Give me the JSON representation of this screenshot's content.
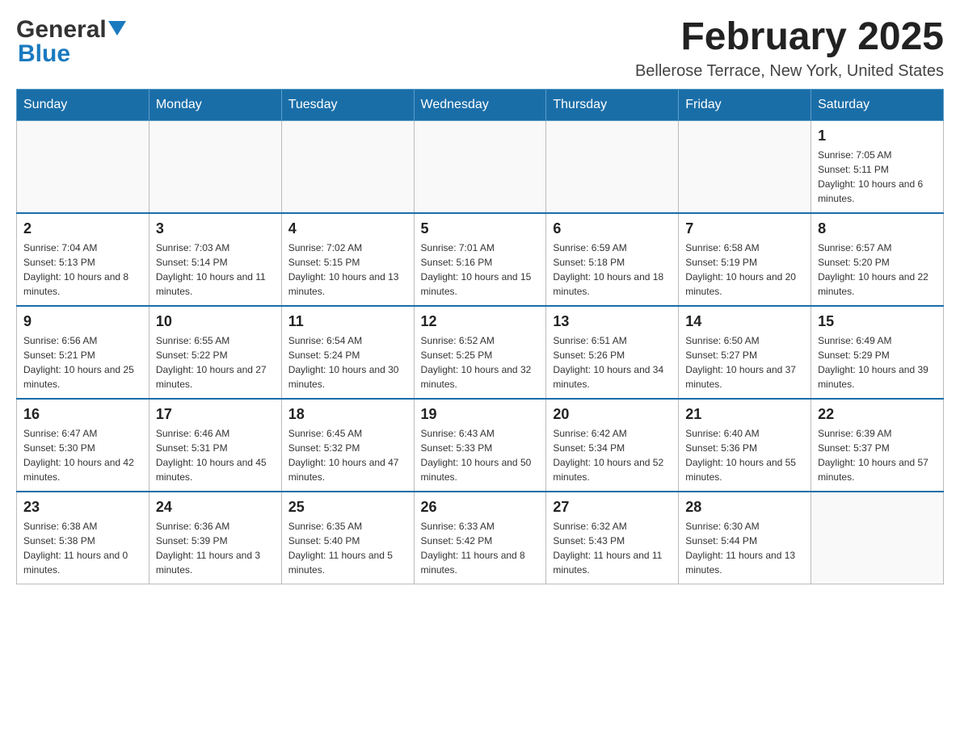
{
  "header": {
    "logo_general": "General",
    "logo_blue": "Blue",
    "month_title": "February 2025",
    "location": "Bellerose Terrace, New York, United States"
  },
  "days_of_week": [
    "Sunday",
    "Monday",
    "Tuesday",
    "Wednesday",
    "Thursday",
    "Friday",
    "Saturday"
  ],
  "weeks": [
    [
      {
        "day": "",
        "info": ""
      },
      {
        "day": "",
        "info": ""
      },
      {
        "day": "",
        "info": ""
      },
      {
        "day": "",
        "info": ""
      },
      {
        "day": "",
        "info": ""
      },
      {
        "day": "",
        "info": ""
      },
      {
        "day": "1",
        "info": "Sunrise: 7:05 AM\nSunset: 5:11 PM\nDaylight: 10 hours and 6 minutes."
      }
    ],
    [
      {
        "day": "2",
        "info": "Sunrise: 7:04 AM\nSunset: 5:13 PM\nDaylight: 10 hours and 8 minutes."
      },
      {
        "day": "3",
        "info": "Sunrise: 7:03 AM\nSunset: 5:14 PM\nDaylight: 10 hours and 11 minutes."
      },
      {
        "day": "4",
        "info": "Sunrise: 7:02 AM\nSunset: 5:15 PM\nDaylight: 10 hours and 13 minutes."
      },
      {
        "day": "5",
        "info": "Sunrise: 7:01 AM\nSunset: 5:16 PM\nDaylight: 10 hours and 15 minutes."
      },
      {
        "day": "6",
        "info": "Sunrise: 6:59 AM\nSunset: 5:18 PM\nDaylight: 10 hours and 18 minutes."
      },
      {
        "day": "7",
        "info": "Sunrise: 6:58 AM\nSunset: 5:19 PM\nDaylight: 10 hours and 20 minutes."
      },
      {
        "day": "8",
        "info": "Sunrise: 6:57 AM\nSunset: 5:20 PM\nDaylight: 10 hours and 22 minutes."
      }
    ],
    [
      {
        "day": "9",
        "info": "Sunrise: 6:56 AM\nSunset: 5:21 PM\nDaylight: 10 hours and 25 minutes."
      },
      {
        "day": "10",
        "info": "Sunrise: 6:55 AM\nSunset: 5:22 PM\nDaylight: 10 hours and 27 minutes."
      },
      {
        "day": "11",
        "info": "Sunrise: 6:54 AM\nSunset: 5:24 PM\nDaylight: 10 hours and 30 minutes."
      },
      {
        "day": "12",
        "info": "Sunrise: 6:52 AM\nSunset: 5:25 PM\nDaylight: 10 hours and 32 minutes."
      },
      {
        "day": "13",
        "info": "Sunrise: 6:51 AM\nSunset: 5:26 PM\nDaylight: 10 hours and 34 minutes."
      },
      {
        "day": "14",
        "info": "Sunrise: 6:50 AM\nSunset: 5:27 PM\nDaylight: 10 hours and 37 minutes."
      },
      {
        "day": "15",
        "info": "Sunrise: 6:49 AM\nSunset: 5:29 PM\nDaylight: 10 hours and 39 minutes."
      }
    ],
    [
      {
        "day": "16",
        "info": "Sunrise: 6:47 AM\nSunset: 5:30 PM\nDaylight: 10 hours and 42 minutes."
      },
      {
        "day": "17",
        "info": "Sunrise: 6:46 AM\nSunset: 5:31 PM\nDaylight: 10 hours and 45 minutes."
      },
      {
        "day": "18",
        "info": "Sunrise: 6:45 AM\nSunset: 5:32 PM\nDaylight: 10 hours and 47 minutes."
      },
      {
        "day": "19",
        "info": "Sunrise: 6:43 AM\nSunset: 5:33 PM\nDaylight: 10 hours and 50 minutes."
      },
      {
        "day": "20",
        "info": "Sunrise: 6:42 AM\nSunset: 5:34 PM\nDaylight: 10 hours and 52 minutes."
      },
      {
        "day": "21",
        "info": "Sunrise: 6:40 AM\nSunset: 5:36 PM\nDaylight: 10 hours and 55 minutes."
      },
      {
        "day": "22",
        "info": "Sunrise: 6:39 AM\nSunset: 5:37 PM\nDaylight: 10 hours and 57 minutes."
      }
    ],
    [
      {
        "day": "23",
        "info": "Sunrise: 6:38 AM\nSunset: 5:38 PM\nDaylight: 11 hours and 0 minutes."
      },
      {
        "day": "24",
        "info": "Sunrise: 6:36 AM\nSunset: 5:39 PM\nDaylight: 11 hours and 3 minutes."
      },
      {
        "day": "25",
        "info": "Sunrise: 6:35 AM\nSunset: 5:40 PM\nDaylight: 11 hours and 5 minutes."
      },
      {
        "day": "26",
        "info": "Sunrise: 6:33 AM\nSunset: 5:42 PM\nDaylight: 11 hours and 8 minutes."
      },
      {
        "day": "27",
        "info": "Sunrise: 6:32 AM\nSunset: 5:43 PM\nDaylight: 11 hours and 11 minutes."
      },
      {
        "day": "28",
        "info": "Sunrise: 6:30 AM\nSunset: 5:44 PM\nDaylight: 11 hours and 13 minutes."
      },
      {
        "day": "",
        "info": ""
      }
    ]
  ]
}
